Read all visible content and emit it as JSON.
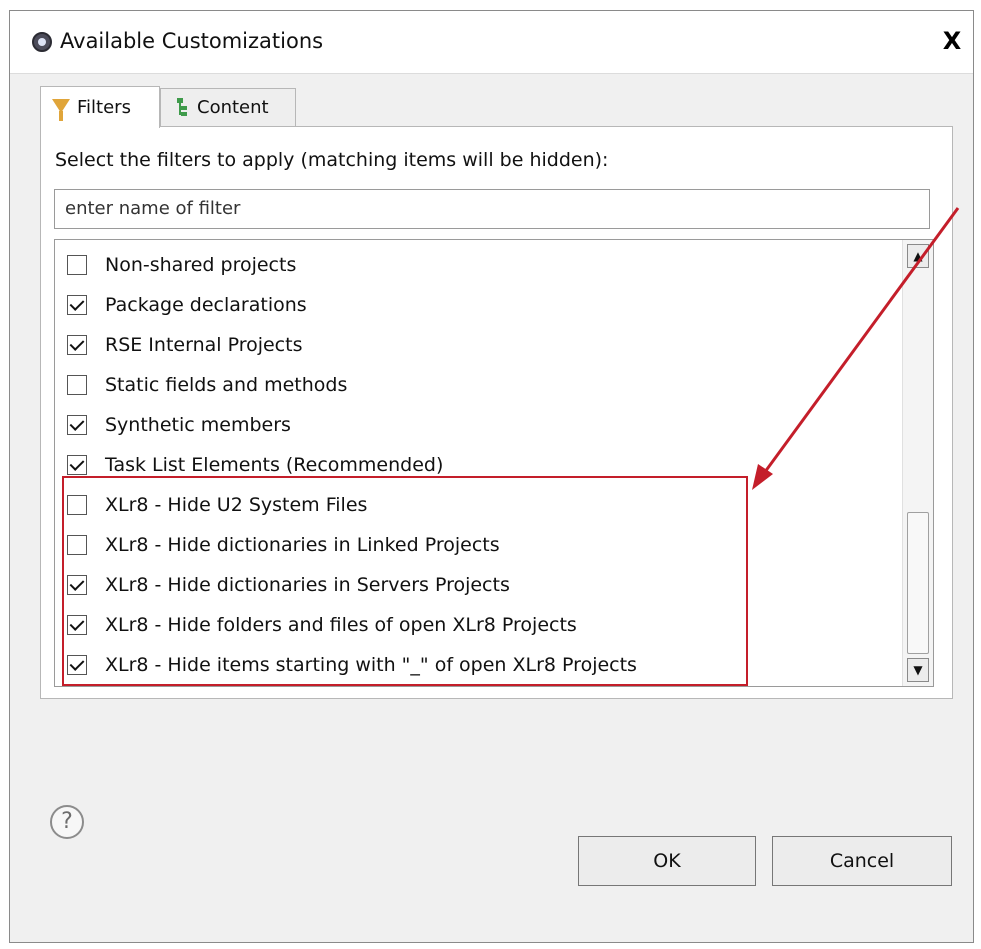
{
  "window": {
    "title": "Available Customizations",
    "close_label": "X"
  },
  "tabs": [
    {
      "label": "Filters",
      "icon": "filter-icon",
      "active": true
    },
    {
      "label": "Content",
      "icon": "tree-icon",
      "active": false
    }
  ],
  "filters": {
    "instruction": "Select the filters to apply (matching items will be hidden):",
    "search_value": "enter name of filter",
    "items": [
      {
        "label": "Non-shared projects",
        "checked": false
      },
      {
        "label": "Package declarations",
        "checked": true
      },
      {
        "label": "RSE Internal Projects",
        "checked": true
      },
      {
        "label": "Static fields and methods",
        "checked": false
      },
      {
        "label": "Synthetic members",
        "checked": true
      },
      {
        "label": "Task List Elements (Recommended)",
        "checked": true
      },
      {
        "label": "XLr8 - Hide U2 System Files",
        "checked": false
      },
      {
        "label": "XLr8 - Hide dictionaries in Linked Projects",
        "checked": false
      },
      {
        "label": "XLr8 - Hide dictionaries in Servers Projects",
        "checked": true
      },
      {
        "label": "XLr8 - Hide folders and files of open XLr8 Projects",
        "checked": true
      },
      {
        "label": "XLr8 - Hide items starting with \"_\" of open XLr8 Projects",
        "checked": true
      }
    ]
  },
  "footer": {
    "help_label": "?",
    "ok_label": "OK",
    "cancel_label": "Cancel"
  },
  "annotation": {
    "color": "#c41e2a"
  }
}
